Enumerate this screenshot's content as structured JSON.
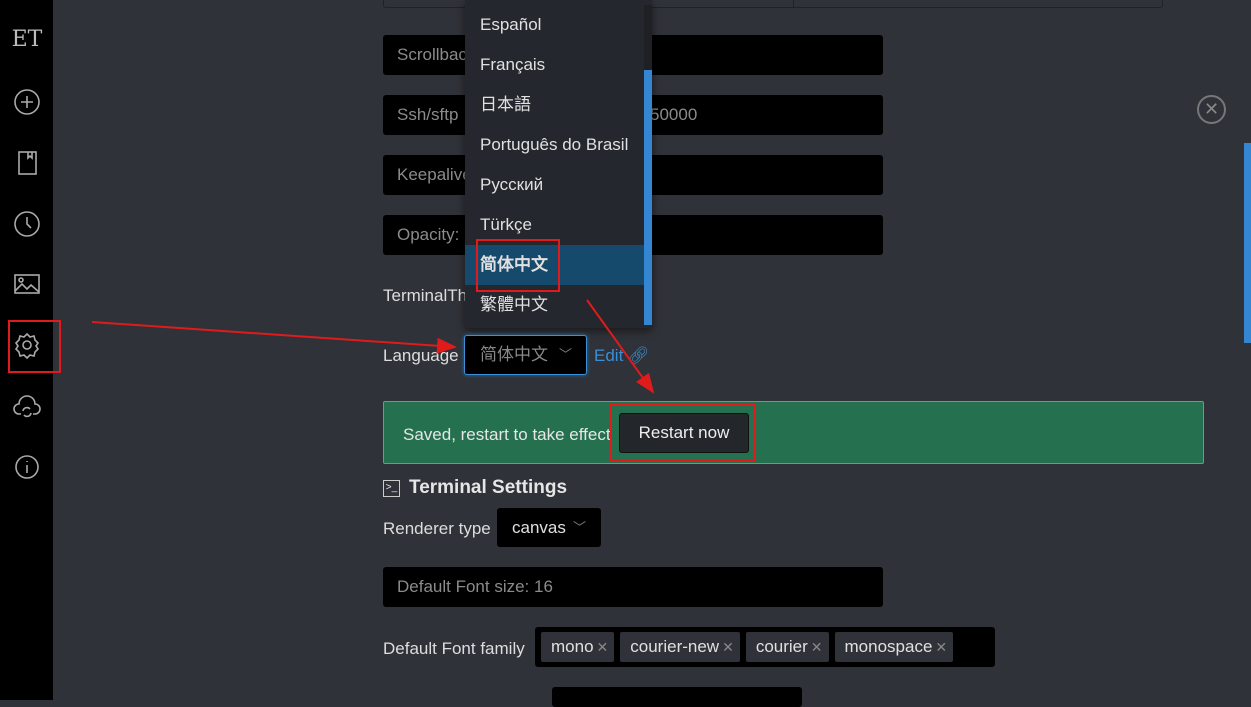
{
  "sidebar": {
    "logo": "ET",
    "items": [
      "add",
      "bookmarks",
      "history",
      "background",
      "settings",
      "cloud-sync",
      "about"
    ]
  },
  "settings": {
    "scrollback_fragment": "Scrollbac",
    "ssh_fragment": "Ssh/sftp",
    "ssh_value_fragment": "50000",
    "keepalive_fragment": "Keepalive",
    "opacity_fragment": "Opacity:",
    "terminal_theme_fragment": "TerminalTh",
    "language_label": "Language",
    "language_value": "简体中文",
    "edit_link": "Edit",
    "banner_text": "Saved, restart to take effect",
    "restart_button": "Restart now"
  },
  "language_options": [
    "Español",
    "Français",
    "日本語",
    "Português do Brasil",
    "Русский",
    "Türkçe",
    "简体中文",
    "繁體中文"
  ],
  "selected_language": "简体中文",
  "terminal": {
    "heading": "Terminal Settings",
    "renderer_label": "Renderer type",
    "renderer_value": "canvas",
    "font_size_placeholder": "Default Font size: 16",
    "font_family_label": "Default Font family",
    "font_families": [
      "mono",
      "courier-new",
      "courier",
      "monospace"
    ]
  },
  "colors": {
    "accent": "#3486d3",
    "banner": "#25704f",
    "annotation": "#e01b1b"
  }
}
